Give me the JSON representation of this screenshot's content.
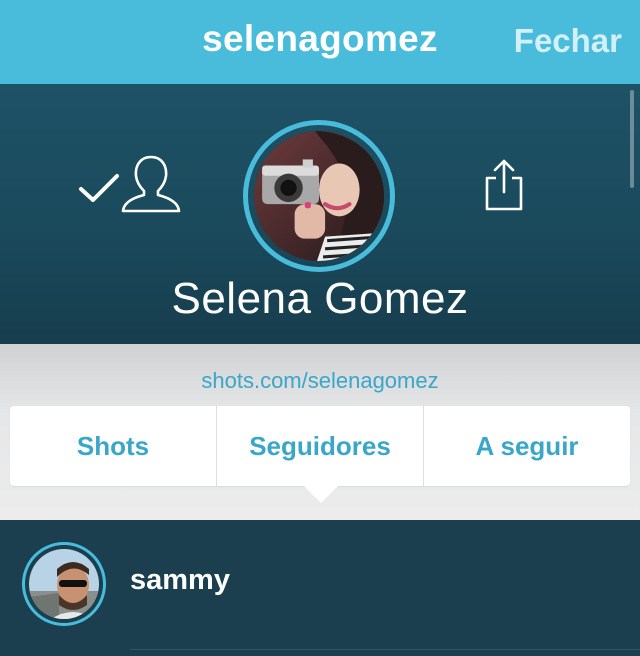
{
  "navbar": {
    "title": "selenagomez",
    "close_label": "Fechar"
  },
  "profile": {
    "name": "Selena Gomez",
    "url": "shots.com/selenagomez",
    "icons": [
      "check-icon",
      "person-icon",
      "share-icon"
    ]
  },
  "tabs": [
    {
      "label": "Shots"
    },
    {
      "label": "Seguidores"
    },
    {
      "label": "A seguir"
    }
  ],
  "users": [
    {
      "username": "sammy"
    }
  ],
  "colors": {
    "accent": "#49bcdc",
    "link": "#3aa6c8",
    "header_bg": "#1e5266",
    "list_bg": "#1b3f4e"
  }
}
